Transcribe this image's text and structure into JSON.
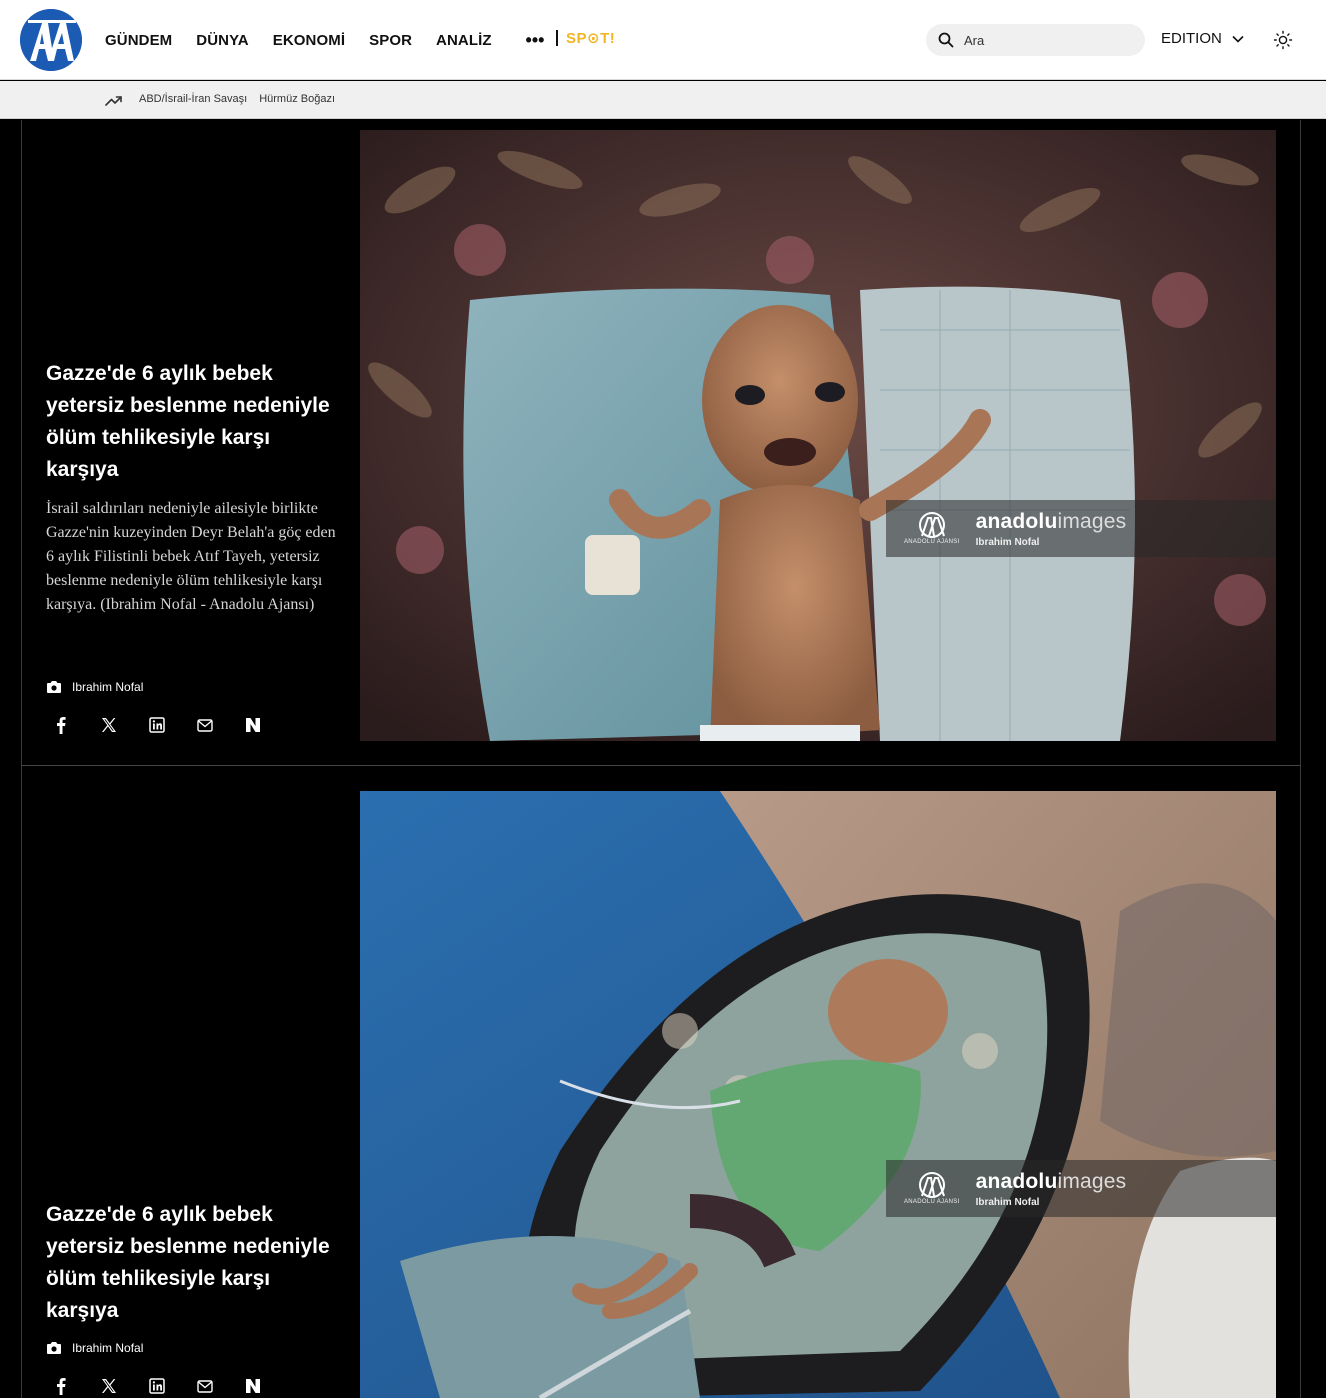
{
  "header": {
    "logo_text": "AA",
    "nav": [
      "GÜNDEM",
      "DÜNYA",
      "EKONOMİ",
      "SPOR",
      "ANALİZ"
    ],
    "more_label": "•••",
    "spot_label": "SP⊙T!",
    "search_placeholder": "Ara",
    "edition_label": "EDITION"
  },
  "trending": {
    "items": [
      "ABD/İsrail-İran Savaşı",
      "Hürmüz Boğazı"
    ]
  },
  "gallery": [
    {
      "title": "Gazze'de 6 aylık bebek yetersiz beslenme nedeniyle ölüm tehlikesiyle karşı karşıya",
      "description": "İsrail saldırıları nedeniyle ailesiyle birlikte Gazze'nin kuzeyinden Deyr Belah'a göç eden 6 aylık Filistinli bebek Atıf Tayeh, yetersiz beslenme nedeniyle ölüm tehlikesiyle karşı karşıya. (Ibrahim Nofal - Anadolu Ajansı)",
      "photographer": "Ibrahim Nofal",
      "watermark_brand_bold": "anadolu",
      "watermark_brand_light": "images",
      "watermark_agency": "ANADOLU AJANSI",
      "watermark_name": "Ibrahim Nofal"
    },
    {
      "title": "Gazze'de 6 aylık bebek yetersiz beslenme nedeniyle ölüm tehlikesiyle karşı karşıya",
      "photographer": "Ibrahim Nofal",
      "watermark_brand_bold": "anadolu",
      "watermark_brand_light": "images",
      "watermark_agency": "ANADOLU AJANSI",
      "watermark_name": "Ibrahim Nofal"
    }
  ],
  "share_icons": [
    "facebook-icon",
    "x-icon",
    "linkedin-icon",
    "mail-icon",
    "nsosyal-icon"
  ],
  "colors": {
    "brand_blue": "#1c5bb4",
    "spot_yellow": "#f2b526",
    "page_bg": "#000000"
  }
}
